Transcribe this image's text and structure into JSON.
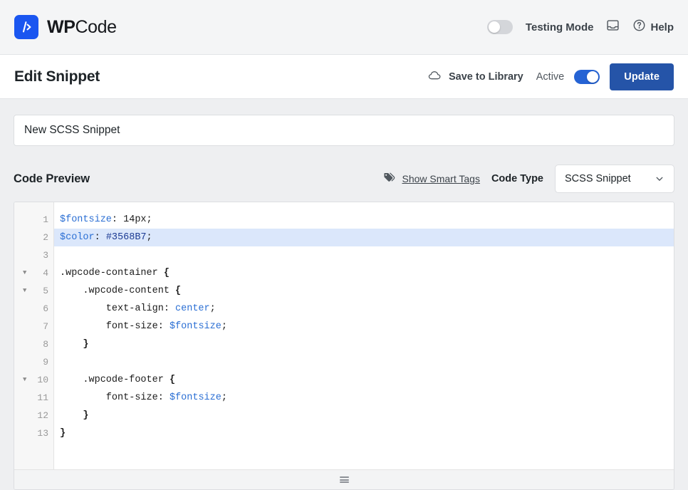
{
  "topbar": {
    "logo_glyph": "/>",
    "brand_bold": "WP",
    "brand_regular": "Code",
    "testing_mode_label": "Testing Mode",
    "testing_mode_state": "off",
    "help_label": "Help",
    "inbox_icon": "inbox-icon",
    "help_icon": "question-circle-icon",
    "brand_color": "#1a56f0"
  },
  "pagehead": {
    "title": "Edit Snippet",
    "save_to_library_label": "Save to Library",
    "cloud_icon": "cloud-icon",
    "active_label": "Active",
    "active_state": "on",
    "update_label": "Update",
    "update_color": "#2554a8"
  },
  "snippet": {
    "title_value": "New SCSS Snippet",
    "title_placeholder": "Give your snippet a name..."
  },
  "preview": {
    "heading": "Code Preview",
    "smart_tags_label": "Show Smart Tags",
    "tags_icon": "tags-icon",
    "code_type_label": "Code Type",
    "code_type_value": "SCSS Snippet",
    "chevron_icon": "chevron-down-icon"
  },
  "editor": {
    "active_line": 2,
    "active_line_color": "#dbe7fb",
    "resize_handle": "resize-grip-icon",
    "lines": [
      {
        "num": "1",
        "fold": false,
        "text": "$fontsize: 14px;"
      },
      {
        "num": "2",
        "fold": false,
        "text": "$color: #3568B7;"
      },
      {
        "num": "3",
        "fold": false,
        "text": ""
      },
      {
        "num": "4",
        "fold": true,
        "text": ".wpcode-container {"
      },
      {
        "num": "5",
        "fold": true,
        "text": "    .wpcode-content {"
      },
      {
        "num": "6",
        "fold": false,
        "text": "        text-align: center;"
      },
      {
        "num": "7",
        "fold": false,
        "text": "        font-size: $fontsize;"
      },
      {
        "num": "8",
        "fold": false,
        "text": "    }"
      },
      {
        "num": "9",
        "fold": false,
        "text": ""
      },
      {
        "num": "10",
        "fold": true,
        "text": "    .wpcode-footer {"
      },
      {
        "num": "11",
        "fold": false,
        "text": "        font-size: $fontsize;"
      },
      {
        "num": "12",
        "fold": false,
        "text": "    }"
      },
      {
        "num": "13",
        "fold": false,
        "text": "}"
      }
    ],
    "tokens": [
      [
        {
          "t": "$fontsize",
          "c": "tok-var"
        },
        {
          "t": ": ",
          "c": "tok-prop"
        },
        {
          "t": "14px",
          "c": "tok-num"
        },
        {
          "t": ";",
          "c": "tok-prop"
        }
      ],
      [
        {
          "t": "$color",
          "c": "tok-var"
        },
        {
          "t": ": ",
          "c": "tok-prop"
        },
        {
          "t": "#3568B7",
          "c": "tok-hex"
        },
        {
          "t": ";",
          "c": "tok-prop"
        }
      ],
      [],
      [
        {
          "t": ".wpcode-container ",
          "c": "tok-sel"
        },
        {
          "t": "{",
          "c": "tok-brace"
        }
      ],
      [
        {
          "t": "    .wpcode-content ",
          "c": "tok-sel"
        },
        {
          "t": "{",
          "c": "tok-brace"
        }
      ],
      [
        {
          "t": "        text-align: ",
          "c": "tok-prop"
        },
        {
          "t": "center",
          "c": "tok-val"
        },
        {
          "t": ";",
          "c": "tok-prop"
        }
      ],
      [
        {
          "t": "        font-size: ",
          "c": "tok-prop"
        },
        {
          "t": "$fontsize",
          "c": "tok-val"
        },
        {
          "t": ";",
          "c": "tok-prop"
        }
      ],
      [
        {
          "t": "    ",
          "c": "tok-prop"
        },
        {
          "t": "}",
          "c": "tok-brace"
        }
      ],
      [],
      [
        {
          "t": "    .wpcode-footer ",
          "c": "tok-sel"
        },
        {
          "t": "{",
          "c": "tok-brace"
        }
      ],
      [
        {
          "t": "        font-size: ",
          "c": "tok-prop"
        },
        {
          "t": "$fontsize",
          "c": "tok-val"
        },
        {
          "t": ";",
          "c": "tok-prop"
        }
      ],
      [
        {
          "t": "    ",
          "c": "tok-prop"
        },
        {
          "t": "}",
          "c": "tok-brace"
        }
      ],
      [
        {
          "t": "}",
          "c": "tok-brace"
        }
      ]
    ]
  }
}
